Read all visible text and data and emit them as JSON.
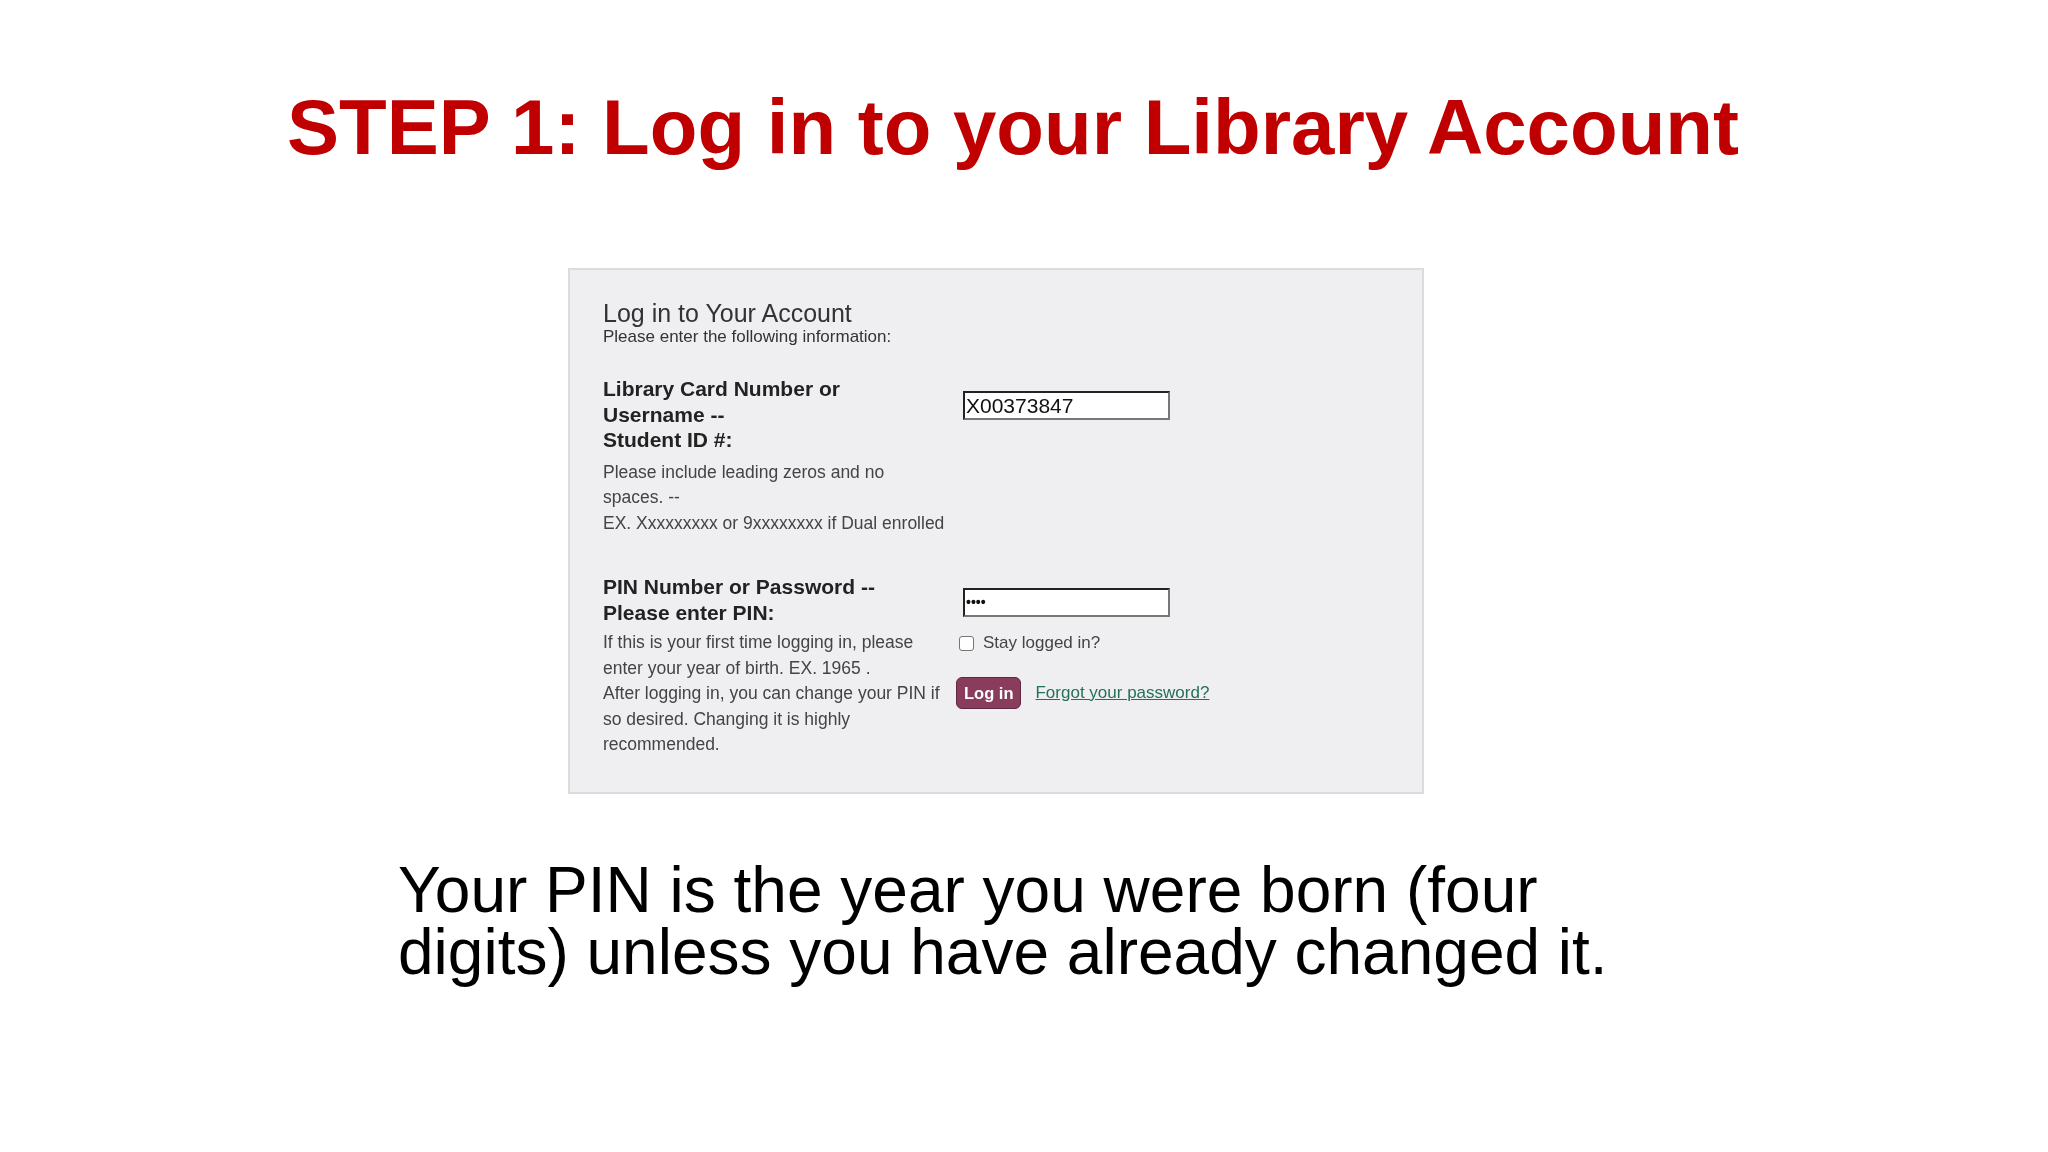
{
  "slide_title": "STEP 1: Log in to your Library Account",
  "login_panel": {
    "title": "Log in to Your Account",
    "subtitle": "Please enter the following information:",
    "fields": [
      {
        "label_lines": [
          "Library Card Number or",
          "Username --",
          "Student ID #:"
        ],
        "hint_lines": [
          "Please include leading zeros and no",
          "spaces. --",
          "EX. Xxxxxxxxx or 9xxxxxxxx if Dual enrolled"
        ],
        "value": "X00373847"
      },
      {
        "label_lines": [
          "PIN Number or Password --",
          "Please enter PIN:"
        ],
        "hint_lines": [
          "If this is your first time logging in, please",
          "enter your year of birth. EX. 1965 .",
          "After logging in, you can change your PIN if",
          "so desired. Changing it is highly",
          "recommended."
        ],
        "value": "••••"
      }
    ],
    "stay_logged_in": {
      "label": "Stay logged in?",
      "checked": false
    },
    "login_button": "Log in",
    "forgot_link": "Forgot your password?"
  },
  "caption_lines": [
    "Your PIN is the year you were born (four",
    "digits) unless you have already changed it."
  ]
}
